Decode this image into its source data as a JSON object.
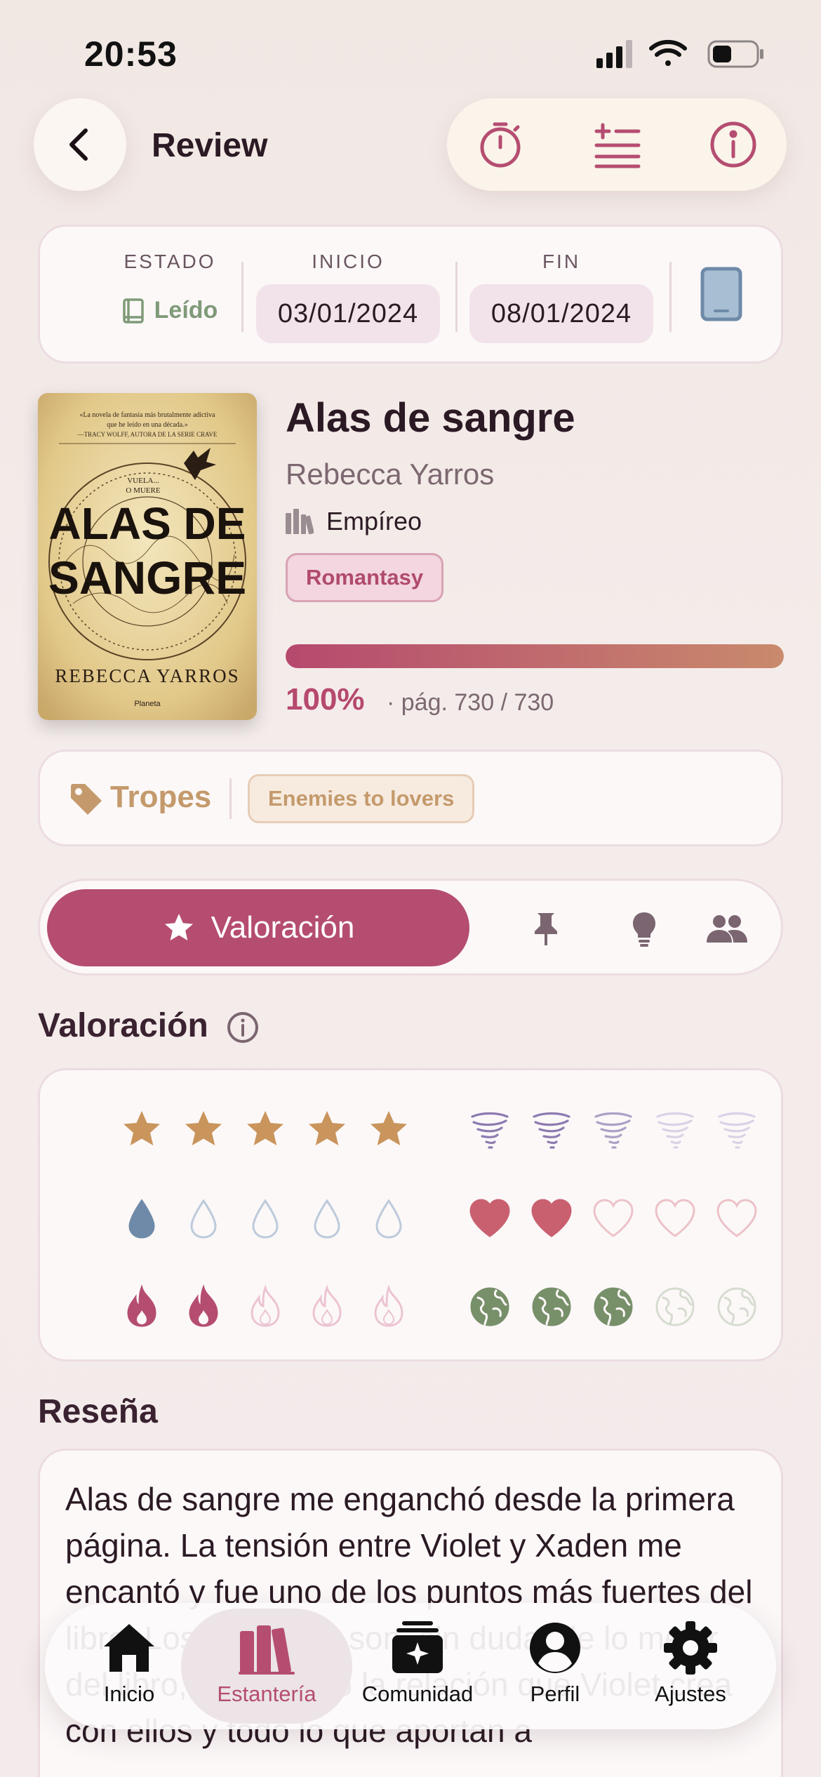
{
  "status_bar": {
    "time": "20:53"
  },
  "header": {
    "title": "Review",
    "icons": [
      "back-arrow-icon",
      "timer-icon",
      "add-list-icon",
      "info-icon"
    ]
  },
  "dates": {
    "estado_label": "ESTADO",
    "estado_value": "Leído",
    "inicio_label": "INICIO",
    "inicio_value": "03/01/2024",
    "fin_label": "FIN",
    "fin_value": "08/01/2024",
    "format_icon": "tablet-icon"
  },
  "book": {
    "title": "Alas de sangre",
    "author": "Rebecca Yarros",
    "series": "Empíreo",
    "genre": "Romantasy",
    "progress_percent": 100,
    "progress_label": "100%",
    "pages_label": "· pág. 730 / 730",
    "cover": {
      "blurb": "«La novela de fantasía más brutalmente adictiva que he leído en una década.» —TRACY WOLFF, AUTORA DE LA SERIE CRAVE",
      "tagline": "VUELA... O MUERE",
      "title_line1": "ALAS DE",
      "title_line2": "SANGRE",
      "author": "REBECCA YARROS",
      "publisher": "Planeta"
    }
  },
  "tropes": {
    "label": "Tropes",
    "items": [
      "Enemies to lovers"
    ]
  },
  "tabs": {
    "active_label": "Valoración",
    "icons": [
      "star-icon",
      "pin-icon",
      "lightbulb-icon",
      "people-icon"
    ]
  },
  "rating": {
    "title": "Valoración",
    "rows": [
      {
        "name": "stars",
        "value": 5,
        "max": 5,
        "color": "#c9955c"
      },
      {
        "name": "tornado",
        "value": 2.5,
        "max": 5,
        "color": "#8d7bb0"
      },
      {
        "name": "tears",
        "value": 1,
        "max": 5,
        "color": "#6e8aa8"
      },
      {
        "name": "hearts",
        "value": 2,
        "max": 5,
        "color": "#c9606f"
      },
      {
        "name": "spice",
        "value": 2,
        "max": 5,
        "color": "#b54d71"
      },
      {
        "name": "worldbuilding",
        "value": 3,
        "max": 5,
        "color": "#78906a"
      }
    ]
  },
  "review": {
    "title": "Reseña",
    "text": "Alas de sangre me enganchó desde la primera página. La tensión entre Violet y Xaden me encantó y fue uno de los puntos más fuertes del libro. Los dragones son, sin duda, de lo mejor del libro, me fascinó la relación que Violet crea con ellos y todo lo que aportan a"
  },
  "nav": {
    "items": [
      {
        "label": "Inicio",
        "icon": "home-icon"
      },
      {
        "label": "Estantería",
        "icon": "books-icon"
      },
      {
        "label": "Comunidad",
        "icon": "community-icon"
      },
      {
        "label": "Perfil",
        "icon": "profile-icon"
      },
      {
        "label": "Ajustes",
        "icon": "gear-icon"
      }
    ],
    "active": "Estantería"
  }
}
